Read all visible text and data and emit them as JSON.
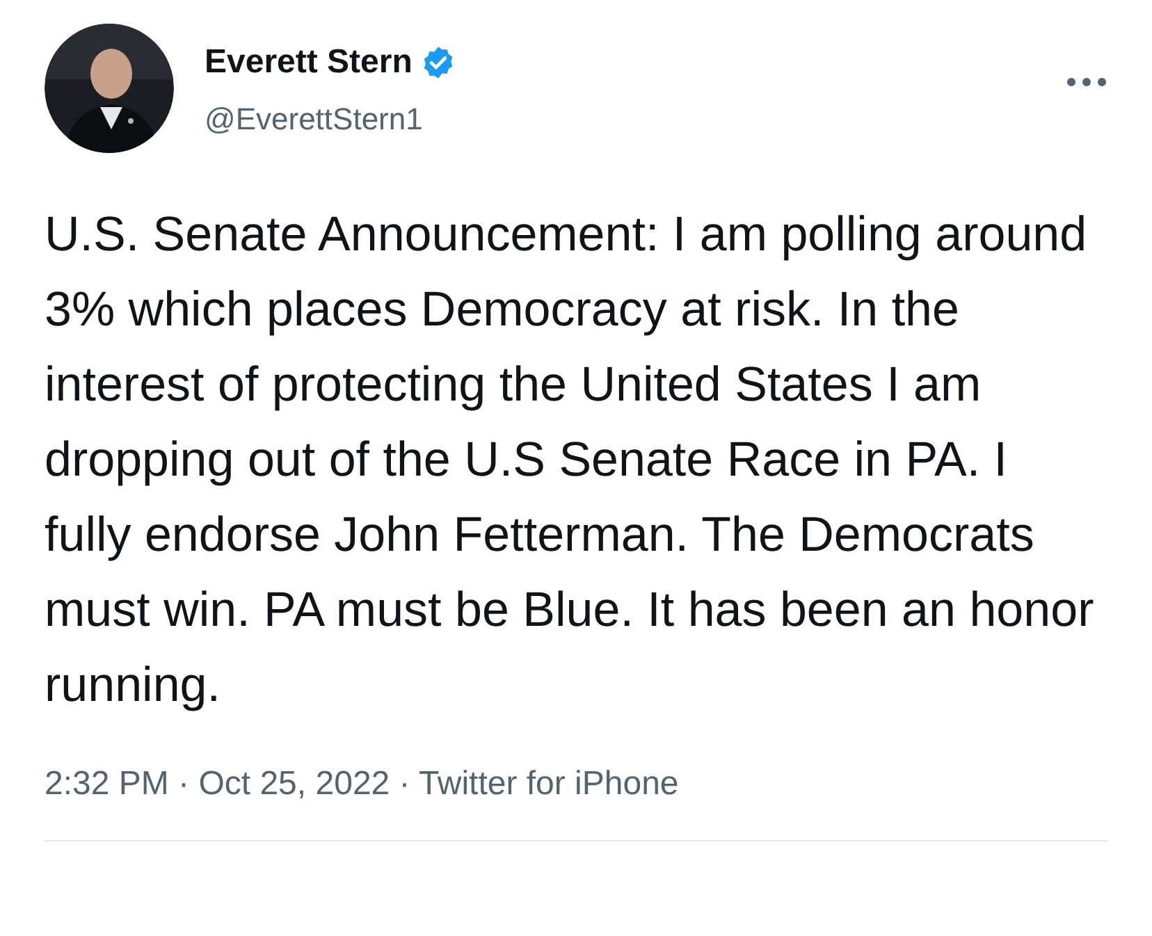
{
  "author": {
    "name": "Everett Stern",
    "handle": "@EverettStern1",
    "verified": true
  },
  "body": "U.S. Senate Announcement: I am polling around 3% which places Democracy at risk. In the interest of protecting the United States I am dropping out of the U.S Senate Race in PA. I fully endorse John Fetterman. The Democrats must win. PA must be Blue. It has been an honor running.",
  "meta": "2:32 PM · Oct 25, 2022 · Twitter for iPhone"
}
